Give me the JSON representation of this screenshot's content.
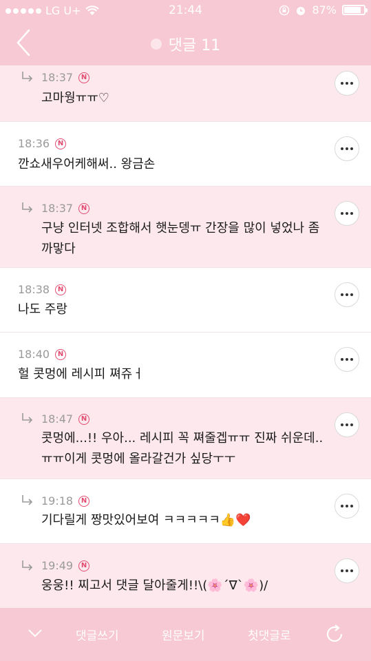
{
  "status": {
    "carrier": "LG U+",
    "time": "21:44",
    "battery": "87%",
    "battery_level": 0.87
  },
  "header": {
    "title": "댓글 11"
  },
  "comments": [
    {
      "time": "18:37",
      "badge": "N",
      "reply": true,
      "lines": [
        "고마웡ㅠㅠ♡"
      ]
    },
    {
      "time": "18:36",
      "badge": "N",
      "reply": false,
      "lines": [
        "깐쇼새우어케해써.. 왕금손"
      ]
    },
    {
      "time": "18:37",
      "badge": "N",
      "reply": true,
      "lines": [
        "구냥 인터넷 조합해서 햇눈뎅ㅠ 간장을 많이 넣었나 좀",
        "까맣다"
      ]
    },
    {
      "time": "18:38",
      "badge": "N",
      "reply": false,
      "lines": [
        "나도 주랑"
      ]
    },
    {
      "time": "18:40",
      "badge": "N",
      "reply": false,
      "lines": [
        "헐 콧멍에 레시피 쪄쥬ㅓ"
      ]
    },
    {
      "time": "18:47",
      "badge": "N",
      "reply": true,
      "lines": [
        "콧멍에...!! 우아... 레시피 꼭 쪄줄겝ㅠㅠ 진짜 쉬운데..",
        "ㅠㅠ이게 콧멍에 올라갈건가 싶당ㅜㅜ"
      ]
    },
    {
      "time": "19:18",
      "badge": "N",
      "reply": true,
      "lines": [
        "기다릴게 짱맛있어보여 ㅋㅋㅋㅋㅋ👍❤️"
      ]
    },
    {
      "time": "19:49",
      "badge": "N",
      "reply": true,
      "lines": [
        "웅웅!! 찌고서 댓글 달아줄게!!\\(🌸´∇`🌸)/"
      ]
    }
  ],
  "bottom": {
    "write": "댓글쓰기",
    "original": "원문보기",
    "first": "첫댓글로"
  },
  "icons": {
    "back": "chevron-left-icon",
    "more": "more-dots-icon",
    "down": "chevron-down-icon",
    "refresh": "refresh-icon",
    "reply": "reply-arrow-icon",
    "badge": "new-badge-icon"
  },
  "colors": {
    "bar": "#f7c9d4",
    "reply_bg": "#fde8ee",
    "badge": "#e34a6f"
  }
}
